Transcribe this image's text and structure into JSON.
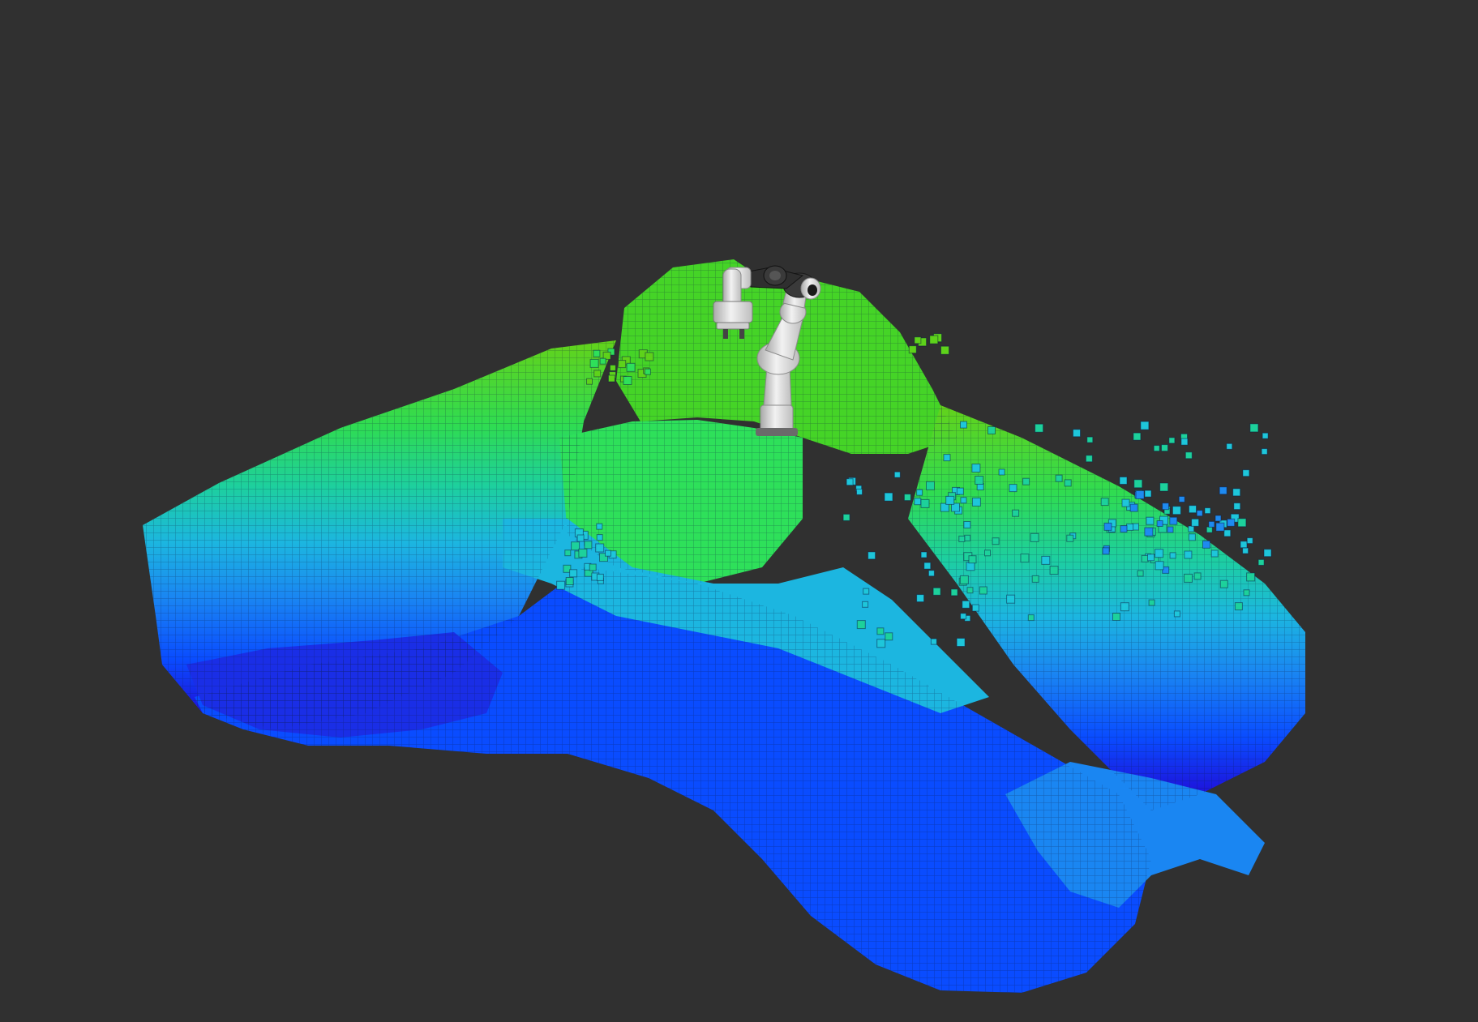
{
  "scene": {
    "background": "#303030",
    "voxel_colormap": [
      "#2a00d6",
      "#0a44ff",
      "#1e8af0",
      "#1ec6da",
      "#1dd19b",
      "#2ee05a",
      "#5ed21a"
    ],
    "voxel_edge_color": "#0a1a40",
    "robot_colors": {
      "link": "#e8e8e8",
      "link_shadow": "#a9a9a9",
      "joint": "#3a3a3a",
      "joint_ring": "#1a1a1a"
    }
  }
}
